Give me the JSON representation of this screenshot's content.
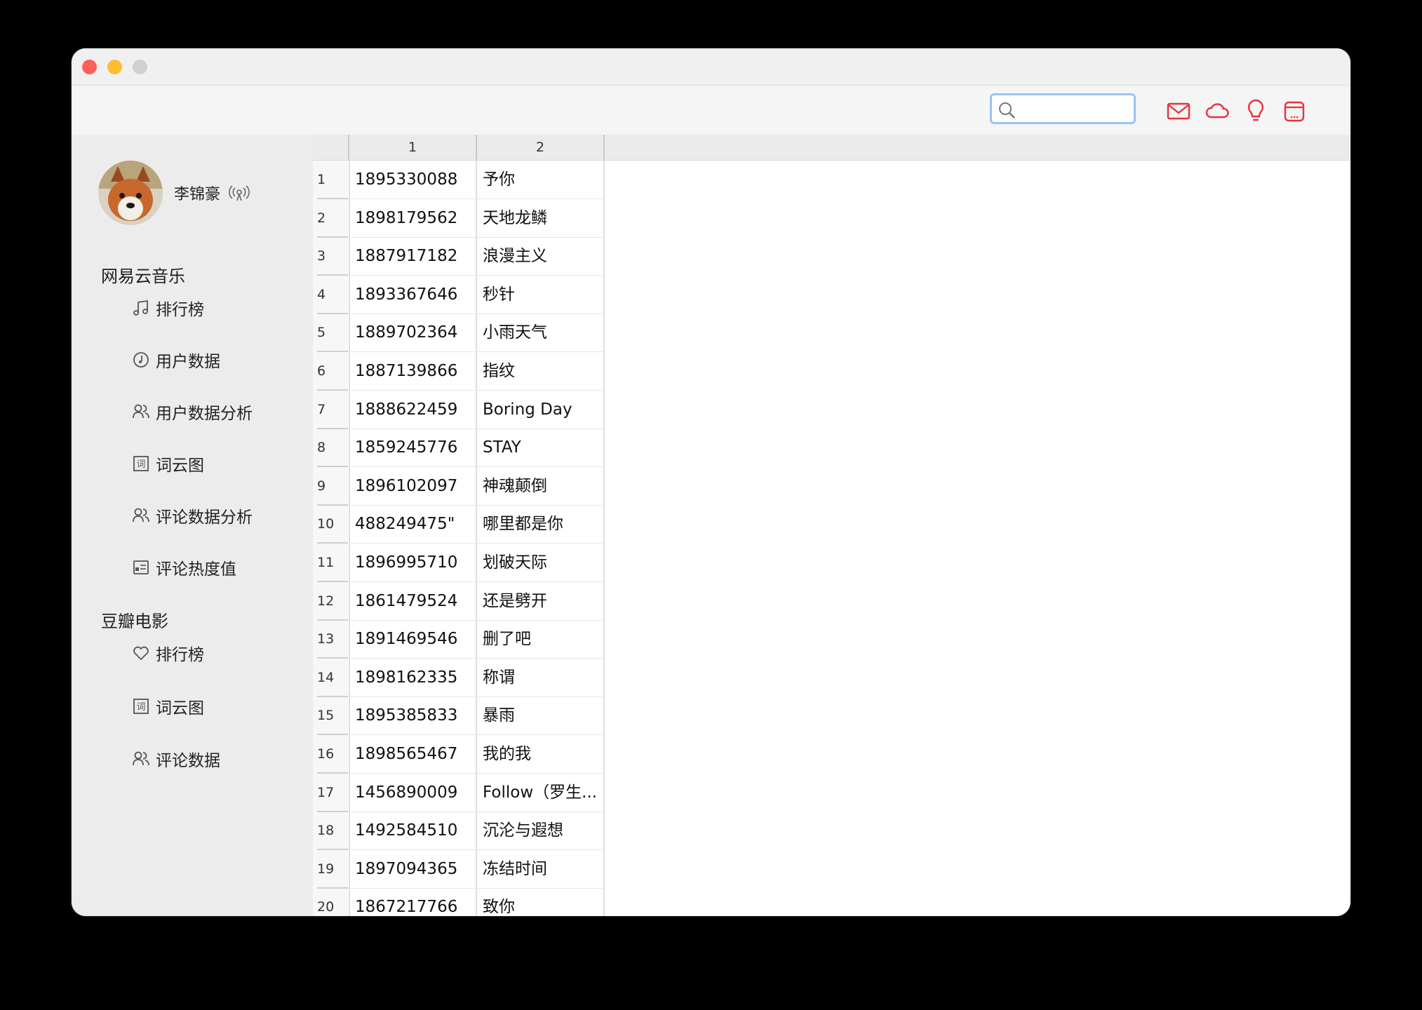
{
  "search": {
    "value": "",
    "placeholder": ""
  },
  "toolbar": {
    "icons": [
      "mail-icon",
      "cloud-icon",
      "lightbulb-icon",
      "skin-icon"
    ],
    "accent": "#e8323c"
  },
  "user": {
    "name": "李锦豪"
  },
  "sidebar": {
    "section1": "网易云音乐",
    "items1": [
      {
        "label": "排行榜",
        "icon": "music-note-icon"
      },
      {
        "label": "用户数据",
        "icon": "clock-music-icon"
      },
      {
        "label": "用户数据分析",
        "icon": "users-icon"
      },
      {
        "label": "词云图",
        "icon": "word-cloud-icon"
      },
      {
        "label": "评论数据分析",
        "icon": "users-icon"
      },
      {
        "label": "评论热度值",
        "icon": "card-list-icon"
      }
    ],
    "section2": "豆瓣电影",
    "items2": [
      {
        "label": "排行榜",
        "icon": "heart-icon"
      },
      {
        "label": "词云图",
        "icon": "word-cloud-icon"
      },
      {
        "label": "评论数据",
        "icon": "users-icon"
      }
    ]
  },
  "table": {
    "headers": [
      "1",
      "2"
    ],
    "rows": [
      {
        "n": "1",
        "a": "1895330088",
        "b": "予你"
      },
      {
        "n": "2",
        "a": "1898179562",
        "b": "天地龙鳞"
      },
      {
        "n": "3",
        "a": "1887917182",
        "b": "浪漫主义"
      },
      {
        "n": "4",
        "a": "1893367646",
        "b": "秒针"
      },
      {
        "n": "5",
        "a": "1889702364",
        "b": "小雨天气"
      },
      {
        "n": "6",
        "a": "1887139866",
        "b": "指纹"
      },
      {
        "n": "7",
        "a": "1888622459",
        "b": "Boring Day"
      },
      {
        "n": "8",
        "a": "1859245776",
        "b": "STAY"
      },
      {
        "n": "9",
        "a": "1896102097",
        "b": "神魂颠倒"
      },
      {
        "n": "10",
        "a": "488249475\"",
        "b": "哪里都是你"
      },
      {
        "n": "11",
        "a": "1896995710",
        "b": "划破天际"
      },
      {
        "n": "12",
        "a": "1861479524",
        "b": "还是劈开"
      },
      {
        "n": "13",
        "a": "1891469546",
        "b": "删了吧"
      },
      {
        "n": "14",
        "a": "1898162335",
        "b": "称谓"
      },
      {
        "n": "15",
        "a": "1895385833",
        "b": "暴雨"
      },
      {
        "n": "16",
        "a": "1898565467",
        "b": "我的我"
      },
      {
        "n": "17",
        "a": "1456890009",
        "b": "Follow（罗生..."
      },
      {
        "n": "18",
        "a": "1492584510",
        "b": "沉沦与遐想"
      },
      {
        "n": "19",
        "a": "1897094365",
        "b": "冻结时间"
      },
      {
        "n": "20",
        "a": "1867217766",
        "b": "致你"
      }
    ]
  }
}
